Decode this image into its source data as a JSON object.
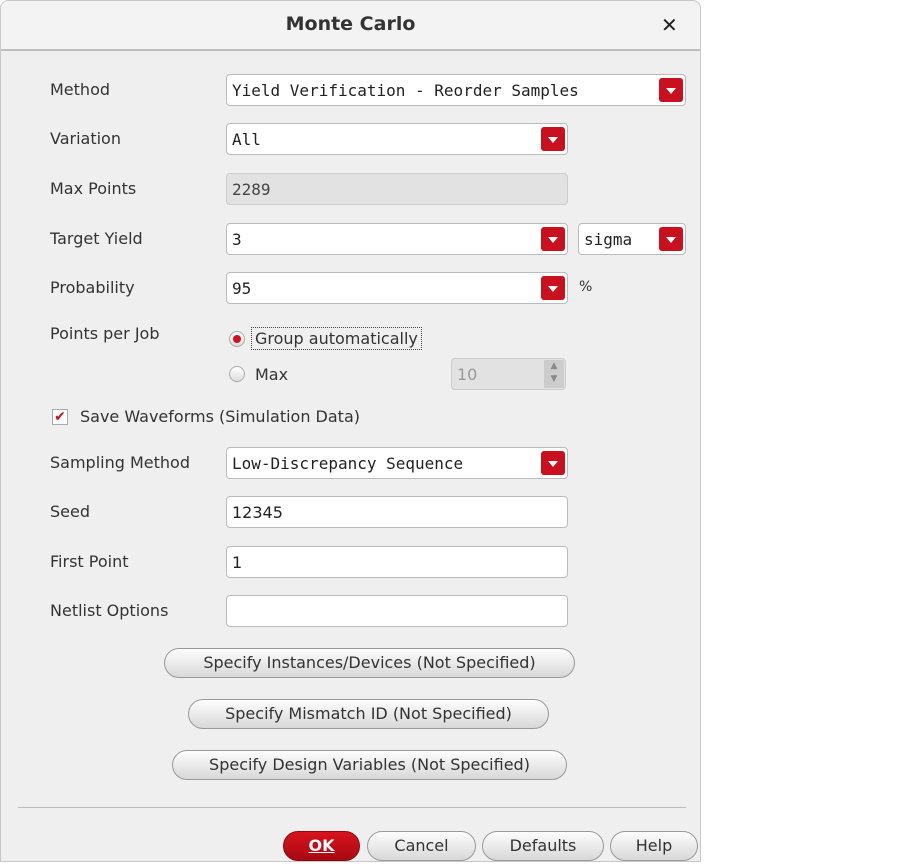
{
  "dialog": {
    "title": "Monte Carlo"
  },
  "labels": {
    "method": "Method",
    "variation": "Variation",
    "max_points": "Max Points",
    "target_yield": "Target Yield",
    "probability": "Probability",
    "points_per_job": "Points per Job",
    "sampling_method": "Sampling Method",
    "seed": "Seed",
    "first_point": "First Point",
    "netlist_options": "Netlist Options"
  },
  "values": {
    "method": "Yield Verification - Reorder Samples",
    "variation": "All",
    "max_points": "2289",
    "target_yield": "3",
    "target_yield_unit": "sigma",
    "probability": "95",
    "probability_unit": "%",
    "group_auto": "Group automatically",
    "max": "Max",
    "max_value": "10",
    "save_waveforms": "Save Waveforms (Simulation Data)",
    "sampling_method": "Low-Discrepancy Sequence",
    "seed": "12345",
    "first_point": "1",
    "netlist_options": ""
  },
  "buttons": {
    "instances": "Specify Instances/Devices (Not Specified)",
    "mismatch": "Specify Mismatch ID (Not Specified)",
    "design_vars": "Specify Design Variables (Not Specified)",
    "ok": "OK",
    "cancel": "Cancel",
    "defaults": "Defaults",
    "help": "Help"
  }
}
